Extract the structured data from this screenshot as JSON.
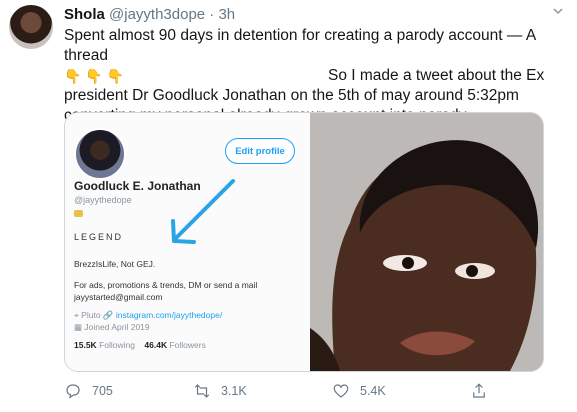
{
  "tweet": {
    "name": "Shola",
    "meta": "@jayyth3dope · 3h",
    "line1": "Spent almost 90 days in detention for creating a parody account — A thread",
    "emojis": "👇👇👇",
    "line2_right": "So I made a tweet about the Ex",
    "line3": "president Dr Goodluck Jonathan on the 5th of may around 5:32pm",
    "line4": "converting my personal already-grown account into parody"
  },
  "embedded_profile": {
    "edit_label": "Edit profile",
    "name": "Goodluck E. Jonathan",
    "handle": "@jayythedope",
    "legend": "LEGEND",
    "bio1": "BrezzIsLife, Not GEJ.",
    "bio2": "For ads, promotions & trends, DM or send a mail jayystarted@gmail.com",
    "location": "Pluto",
    "link": "instagram.com/jayythedope/",
    "joined": "Joined April 2019",
    "following_count": "15.5K",
    "following_label": "Following",
    "followers_count": "46.4K",
    "followers_label": "Followers"
  },
  "actions": {
    "replies": "705",
    "retweets": "3.1K",
    "likes": "5.4K"
  },
  "icons": [
    "chevron-down-icon",
    "reply-icon",
    "retweet-icon",
    "like-icon",
    "share-icon",
    "location-icon",
    "link-icon",
    "calendar-icon"
  ],
  "colors": {
    "accent": "#1da1f2",
    "text": "#14171a",
    "muted": "#657786"
  }
}
